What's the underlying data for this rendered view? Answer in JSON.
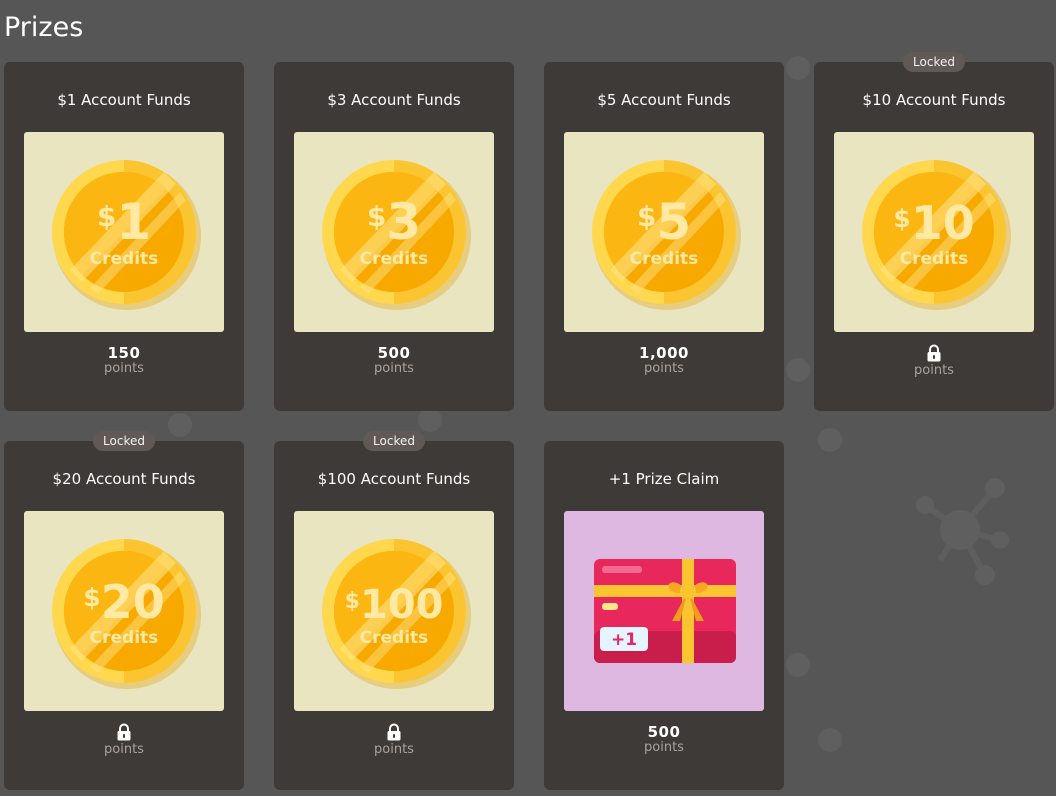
{
  "page": {
    "title": "Prizes"
  },
  "theme": {
    "background": "#565656",
    "card_bg": "#3d3a37",
    "coin_tile_bg": "#e8e5c0",
    "gift_tile_bg": "#dfb8e2",
    "coin_gold": "#fbbf24",
    "muted_text": "#a9a39e"
  },
  "prizes": [
    {
      "title": "$1 Account Funds",
      "coin_amount": "1",
      "coin_label": "Credits",
      "cost": "150",
      "cost_unit": "points",
      "locked": false,
      "icon": "coin-icon"
    },
    {
      "title": "$3 Account Funds",
      "coin_amount": "3",
      "coin_label": "Credits",
      "cost": "500",
      "cost_unit": "points",
      "locked": false,
      "icon": "coin-icon"
    },
    {
      "title": "$5 Account Funds",
      "coin_amount": "5",
      "coin_label": "Credits",
      "cost": "1,000",
      "cost_unit": "points",
      "locked": false,
      "icon": "coin-icon"
    },
    {
      "title": "$10 Account Funds",
      "coin_amount": "10",
      "coin_label": "Credits",
      "cost_unit": "points",
      "locked": true,
      "badge": "Locked",
      "icon": "coin-icon"
    },
    {
      "title": "$20 Account Funds",
      "coin_amount": "20",
      "coin_label": "Credits",
      "cost_unit": "points",
      "locked": true,
      "badge": "Locked",
      "icon": "coin-icon"
    },
    {
      "title": "$100 Account Funds",
      "coin_amount": "100",
      "coin_label": "Credits",
      "cost_unit": "points",
      "locked": true,
      "badge": "Locked",
      "icon": "coin-icon"
    },
    {
      "title": "+1 Prize Claim",
      "gift_label": "+1",
      "cost": "500",
      "cost_unit": "points",
      "locked": false,
      "icon": "gift-card-icon"
    }
  ]
}
